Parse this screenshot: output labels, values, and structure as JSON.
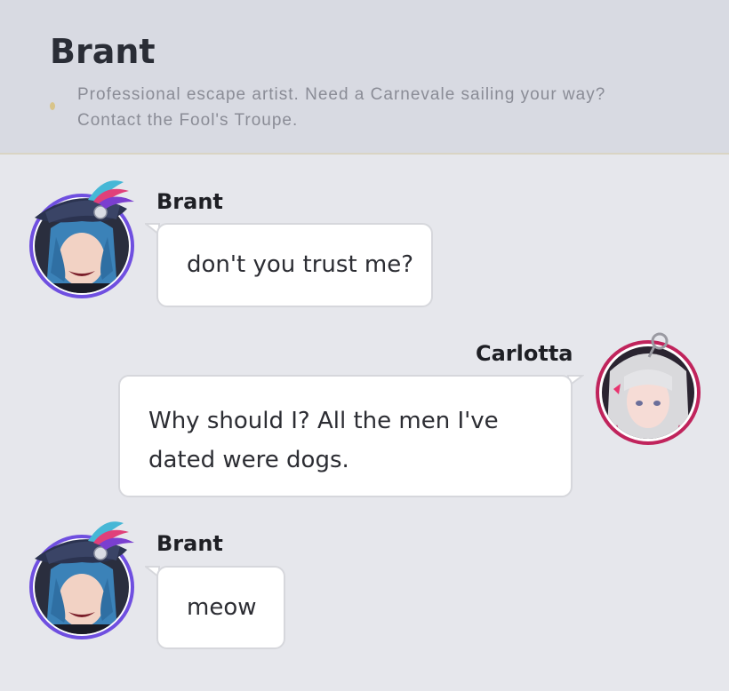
{
  "header": {
    "title": "Brant",
    "bio": "Professional escape artist. Need a Carnevale sailing your way? Contact the Fool's Troupe."
  },
  "messages": [
    {
      "sender": "Brant",
      "text": "don't you trust me?",
      "side": "left",
      "avatar": "brant-avatar"
    },
    {
      "sender": "Carlotta",
      "text": "Why should I? All the men I've dated were dogs.",
      "side": "right",
      "avatar": "carlotta-avatar"
    },
    {
      "sender": "Brant",
      "text": "meow",
      "side": "left",
      "avatar": "brant-avatar"
    }
  ],
  "colors": {
    "background": "#e6e7ec",
    "header_bg": "#d8dae2",
    "brant_ring": "#6f4fe0",
    "carlotta_ring": "#c0245c",
    "bubble_bg": "#ffffff"
  }
}
